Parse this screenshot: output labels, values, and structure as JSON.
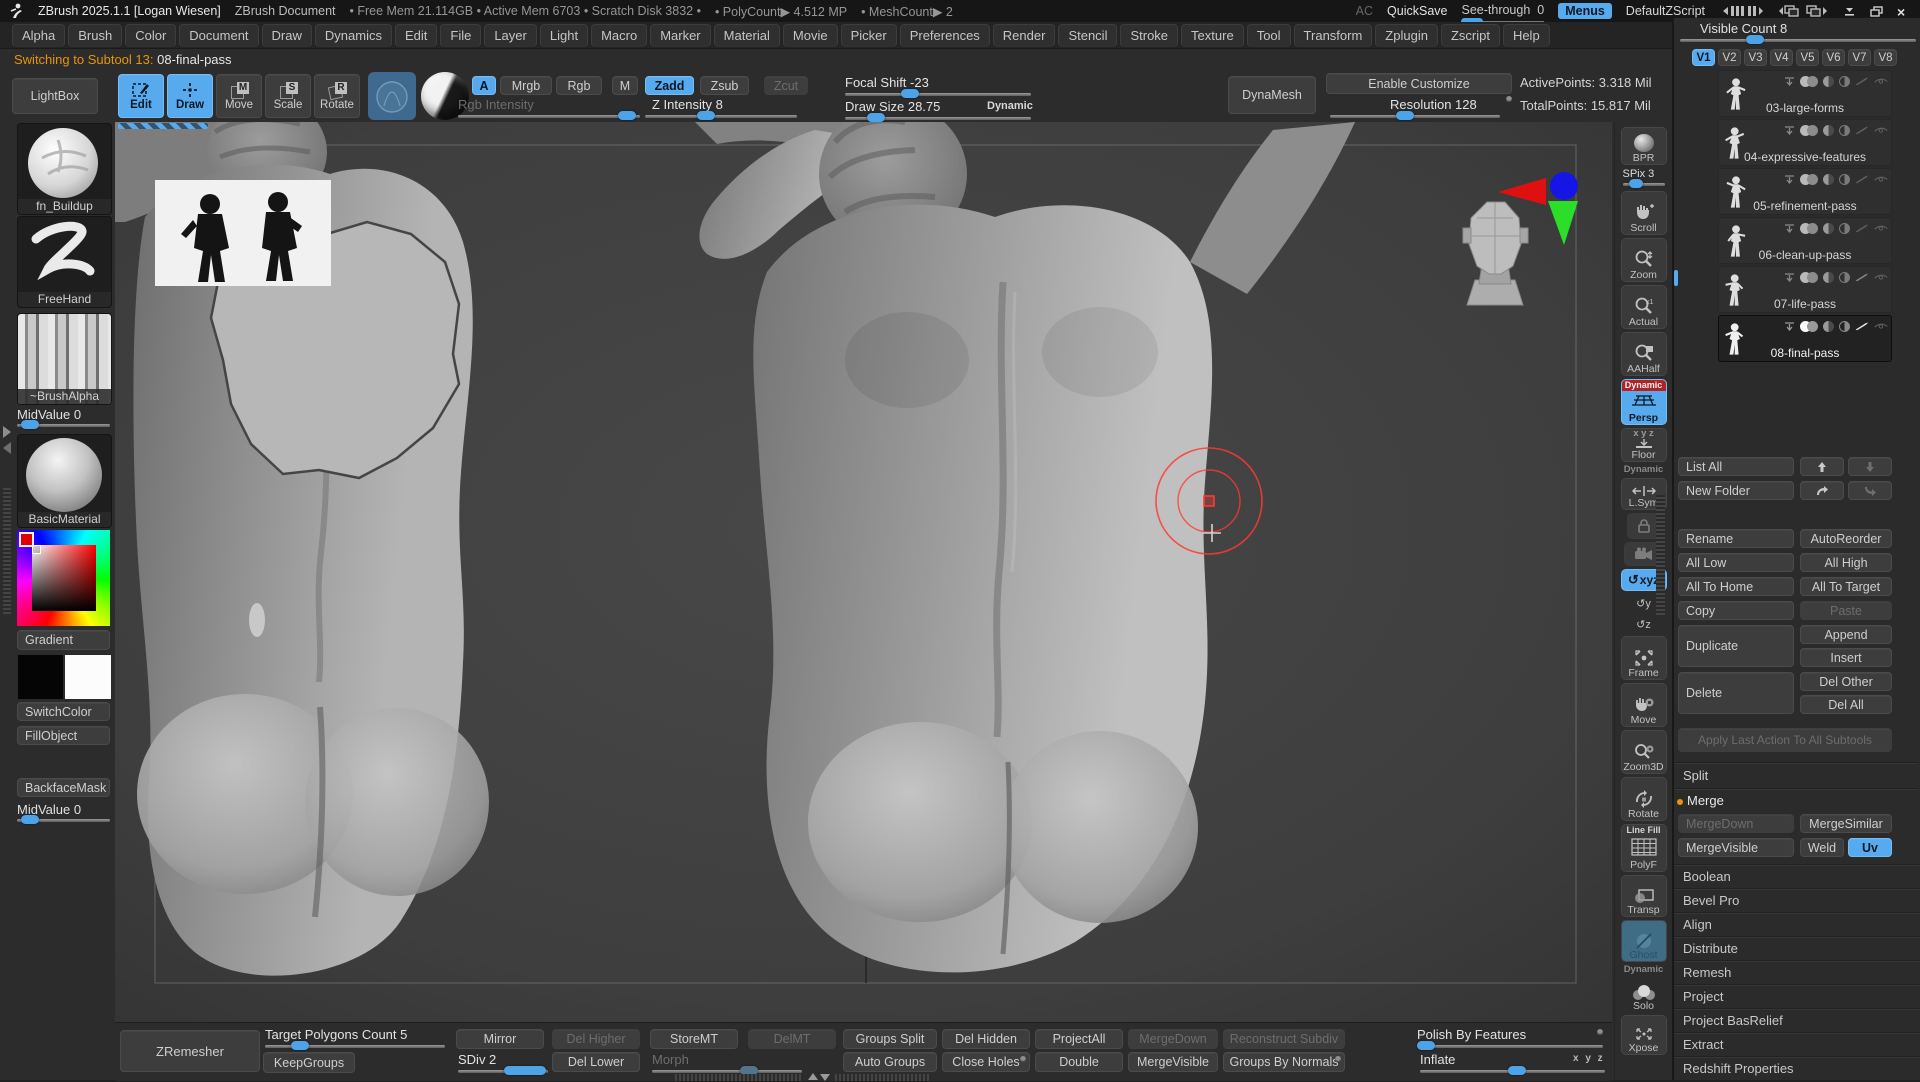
{
  "app": {
    "title": "ZBrush 2025.1.1 [Logan Wiesen]",
    "document_name": "ZBrush Document",
    "stats": "• Free Mem 21.114GB • Active Mem 6703 • Scratch Disk 3832 •",
    "polycount": "• PolyCount▶ 4.512 MP",
    "meshcount": "• MeshCount▶ 2",
    "ac": "AC",
    "quicksave": "QuickSave",
    "see_through_label": "See-through",
    "see_through_value": "0",
    "menus": "Menus",
    "zscript": "DefaultZScript"
  },
  "menu_bar": {
    "items": [
      "Alpha",
      "Brush",
      "Color",
      "Document",
      "Draw",
      "Dynamics",
      "Edit",
      "File",
      "Layer",
      "Light",
      "Macro",
      "Marker",
      "Material",
      "Movie",
      "Picker",
      "Preferences",
      "Render",
      "Stencil",
      "Stroke",
      "Texture",
      "Tool",
      "Transform",
      "Zplugin",
      "Zscript",
      "Help"
    ]
  },
  "status": {
    "prefix": "Switching to Subtool 13:",
    "subtool": "08-final-pass"
  },
  "shelf": {
    "lightbox": "LightBox",
    "edit": "Edit",
    "draw": "Draw",
    "move": "Move",
    "scale": "Scale",
    "rotate": "Rotate",
    "move_badge": "M",
    "scale_badge": "S",
    "rotate_badge": "R",
    "a": "A",
    "mrgb": "Mrgb",
    "rgb": "Rgb",
    "m": "M",
    "zadd": "Zadd",
    "zsub": "Zsub",
    "zcut": "Zcut",
    "rgb_intensity": "Rgb Intensity",
    "z_intensity": "Z Intensity 8",
    "focal_shift": "Focal Shift -23",
    "draw_size": "Draw Size 28.75",
    "dynamic": "Dynamic",
    "dynamesh": "DynaMesh",
    "enable_customize": "Enable Customize",
    "resolution": "Resolution 128",
    "active_points": "ActivePoints: 3.318 Mil",
    "total_points": "TotalPoints: 15.817 Mil"
  },
  "left_panel": {
    "brush": "fn_Buildup",
    "stroke": "FreeHand",
    "alpha": "~BrushAlpha",
    "midvalue_top": "MidValue 0",
    "material": "BasicMaterial",
    "gradient": "Gradient",
    "switch_color": "SwitchColor",
    "fill_object": "FillObject",
    "backface_mask": "BackfaceMask",
    "midvalue_bottom": "MidValue 0"
  },
  "right_shelf": {
    "bpr": "BPR",
    "spix": "SPix 3",
    "scroll": "Scroll",
    "zoom": "Zoom",
    "actual": "Actual",
    "aahalf": "AAHalf",
    "persp": "Persp",
    "persp_overlay": "Dynamic",
    "floor": "Floor",
    "floor_axes": "x y z",
    "lsym_overlay": "Dynamic",
    "lsym": "L.Sym",
    "gxyz": "xyz",
    "frame": "Frame",
    "move": "Move",
    "zoom3d": "Zoom3D",
    "rotate": "Rotate",
    "linefill_overlay": "Line Fill",
    "polyf": "PolyF",
    "transp": "Transp",
    "ghost": "Ghost",
    "solo_overlay": "Dynamic",
    "solo": "Solo",
    "xpose": "Xpose"
  },
  "tool_panel": {
    "visible_count": "Visible Count 8",
    "tabs": [
      "V1",
      "V2",
      "V3",
      "V4",
      "V5",
      "V6",
      "V7",
      "V8"
    ],
    "subtools": [
      {
        "name": "03-large-forms"
      },
      {
        "name": "04-expressive-features"
      },
      {
        "name": "05-refinement-pass"
      },
      {
        "name": "06-clean-up-pass"
      },
      {
        "name": "07-life-pass"
      },
      {
        "name": "08-final-pass"
      }
    ],
    "list_all": "List All",
    "new_folder": "New Folder",
    "rename": "Rename",
    "autoreorder": "AutoReorder",
    "all_low": "All Low",
    "all_high": "All High",
    "all_to_home": "All To Home",
    "all_to_target": "All To Target",
    "copy": "Copy",
    "paste": "Paste",
    "duplicate": "Duplicate",
    "append": "Append",
    "insert": "Insert",
    "delete": "Delete",
    "del_other": "Del Other",
    "del_all": "Del All",
    "apply_last": "Apply Last Action To All Subtools",
    "split": "Split",
    "merge": "Merge",
    "merge_down": "MergeDown",
    "merge_similar": "MergeSimilar",
    "merge_visible": "MergeVisible",
    "weld": "Weld",
    "uv": "Uv",
    "sections": [
      "Boolean",
      "Bevel Pro",
      "Align",
      "Distribute",
      "Remesh",
      "Project",
      "Project BasRelief",
      "Extract",
      "Redshift Properties"
    ]
  },
  "bottom_bar": {
    "zremesher": "ZRemesher",
    "target_polygons": "Target Polygons Count 5",
    "keep_groups": "KeepGroups",
    "mirror": "Mirror",
    "sdiv": "SDiv 2",
    "del_higher": "Del Higher",
    "del_lower": "Del Lower",
    "storemt": "StoreMT",
    "morph": "Morph",
    "delmt": "DelMT",
    "groups_split": "Groups Split",
    "auto_groups": "Auto Groups",
    "del_hidden": "Del Hidden",
    "close_holes": "Close Holes",
    "project_all": "ProjectAll",
    "double": "Double",
    "merge_down": "MergeDown",
    "merge_visible": "MergeVisible",
    "reconstruct_subdiv": "Reconstruct Subdiv",
    "groups_by_normals": "Groups By Normals",
    "polish_by_features": "Polish By Features",
    "inflate": "Inflate",
    "axes": "x y z"
  },
  "colors": {
    "accent": "#58aaee",
    "warning_text": "#e8940c",
    "dynamic_red": "#b22222",
    "ghost_teal": "#3e6d85",
    "cursor_red": "#ff3a30"
  }
}
